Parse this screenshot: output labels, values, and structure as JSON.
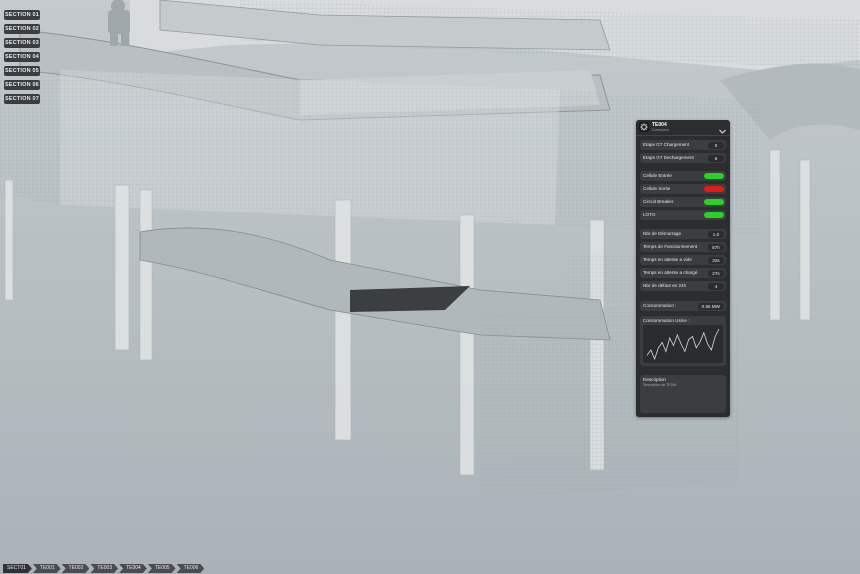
{
  "sections": [
    "SECTION 01",
    "SECTION 02",
    "SECTION 03",
    "SECTION 04",
    "SECTION 05",
    "SECTION 06",
    "SECTION 07"
  ],
  "breadcrumb": [
    "SECT01",
    "TE001",
    "TE002",
    "TE003",
    "TE004",
    "TE005",
    "TE006"
  ],
  "panel": {
    "title": "TE004",
    "subtitle": "Convoyeur",
    "rows_value": [
      {
        "label": "Etape G7 Chargement",
        "value": "0"
      },
      {
        "label": "Etape G7 Dechargement",
        "value": "6"
      }
    ],
    "rows_status": [
      {
        "label": "Cellule Entrée",
        "color": "#27d421"
      },
      {
        "label": "Cellule Sortie",
        "color": "#e41a14"
      },
      {
        "label": "Circuit Breaker",
        "color": "#27d421"
      },
      {
        "label": "LOTO",
        "color": "#27d421"
      }
    ],
    "rows_stats": [
      {
        "label": "Nbr de Démarrage",
        "value": "1.0"
      },
      {
        "label": "Temps de Fonctionnement",
        "value": "87h"
      },
      {
        "label": "Temps en attente a vide",
        "value": "32s"
      },
      {
        "label": "Temps en attente a chargé",
        "value": "27s"
      },
      {
        "label": "Nbr de défaut en 24h",
        "value": "4"
      }
    ],
    "consumption": {
      "label": "Consommation :",
      "value": "0.55 MW"
    },
    "usage": {
      "title": "Consommation Usine :",
      "series": [
        0.45,
        0.52,
        0.4,
        0.55,
        0.62,
        0.5,
        0.68,
        0.58,
        0.72,
        0.6,
        0.5,
        0.66,
        0.7,
        0.55,
        0.63,
        0.75,
        0.6,
        0.52,
        0.7,
        0.8
      ]
    },
    "description": {
      "title": "Description",
      "text": "Description de TE004"
    }
  }
}
